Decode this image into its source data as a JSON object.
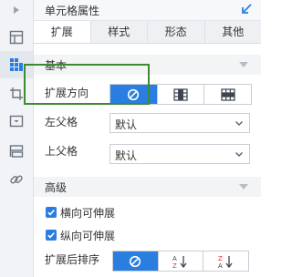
{
  "panel": {
    "title": "单元格属性",
    "tabs": [
      {
        "label": "扩展",
        "active": true
      },
      {
        "label": "样式",
        "active": false
      },
      {
        "label": "形态",
        "active": false
      },
      {
        "label": "其他",
        "active": false
      }
    ]
  },
  "basic": {
    "section_label": "基本",
    "expand_direction": {
      "label": "扩展方向",
      "options": [
        "no-expand-icon",
        "vertical-expand-icon",
        "horizontal-expand-icon"
      ],
      "selected_index": 0
    },
    "left_parent": {
      "label": "左父格",
      "value": "默认"
    },
    "top_parent": {
      "label": "上父格",
      "value": "默认"
    }
  },
  "advanced": {
    "section_label": "高级",
    "horizontal_extend": {
      "label": "横向可伸展",
      "checked": true
    },
    "vertical_extend": {
      "label": "纵向可伸展",
      "checked": true
    },
    "sort_after_expand": {
      "label": "扩展后排序",
      "options": [
        "no-sort-icon",
        "sort-ascending-icon",
        "sort-descending-icon"
      ],
      "selected_index": 0,
      "sort_glyph_az": "A Z",
      "sort_glyph_za": "Z A"
    }
  },
  "colors": {
    "accent": "#2a7de1",
    "highlight_border": "#3e8a31"
  }
}
